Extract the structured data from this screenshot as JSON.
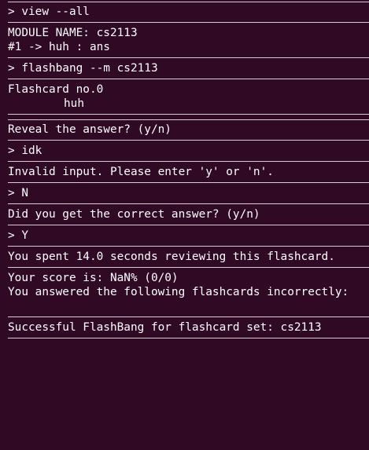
{
  "lines": {
    "cmd_view": "> view --all",
    "module_name": "MODULE NAME: cs2113",
    "card_entry": "#1 -> huh : ans",
    "cmd_flashbang": "> flashbang --m cs2113",
    "flashcard_no": "Flashcard no.0",
    "flashcard_question": "huh",
    "reveal_prompt": "Reveal the answer? (y/n)",
    "input_idk": "> idk",
    "invalid_input": "Invalid input. Please enter 'y' or 'n'.",
    "input_n": "> N",
    "correct_prompt": "Did you get the correct answer? (y/n)",
    "input_y": "> Y",
    "time_spent": "You spent 14.0 seconds reviewing this flashcard.",
    "score": "Your score is: NaN% (0/0)",
    "incorrect_header": "You answered the following flashcards incorrectly:",
    "success": "Successful FlashBang for flashcard set: cs2113"
  },
  "colors": {
    "background": "#300a24",
    "text": "#ffffff",
    "rule": "#d8ccd4"
  }
}
